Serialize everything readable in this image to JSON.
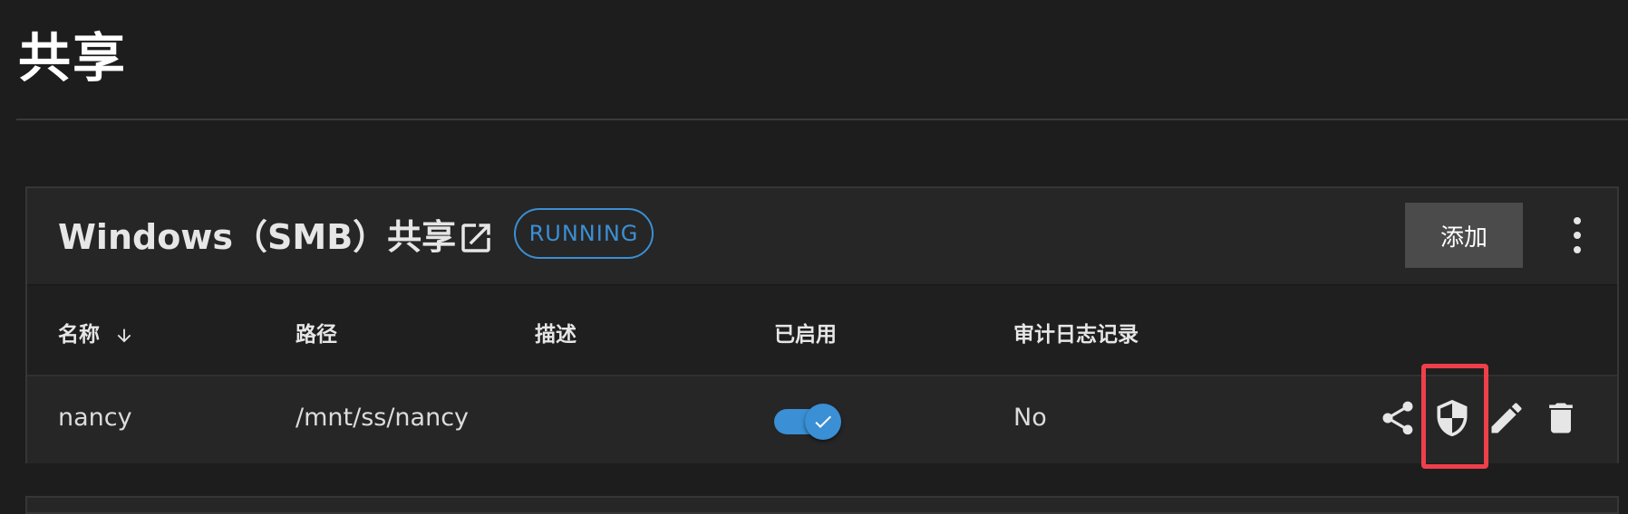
{
  "page": {
    "title": "共享"
  },
  "smb_card": {
    "title": "Windows（SMB）共享",
    "status": "RUNNING",
    "add_label": "添加"
  },
  "table": {
    "columns": {
      "name": "名称",
      "path": "路径",
      "description": "描述",
      "enabled": "已启用",
      "audit": "审计日志记录"
    },
    "rows": [
      {
        "name": "nancy",
        "path": "/mnt/ss/nancy",
        "description": "",
        "enabled": true,
        "audit": "No"
      }
    ]
  },
  "colors": {
    "accent": "#3b8fd4",
    "highlight": "#ef3f4a",
    "background": "#1d1d1d"
  },
  "icons": {
    "external_link": "open-in-new-icon",
    "more": "more-vert-icon",
    "sort": "arrow-down-icon",
    "share": "share-icon",
    "acl": "security-shield-icon",
    "edit": "pencil-icon",
    "delete": "trash-icon"
  }
}
